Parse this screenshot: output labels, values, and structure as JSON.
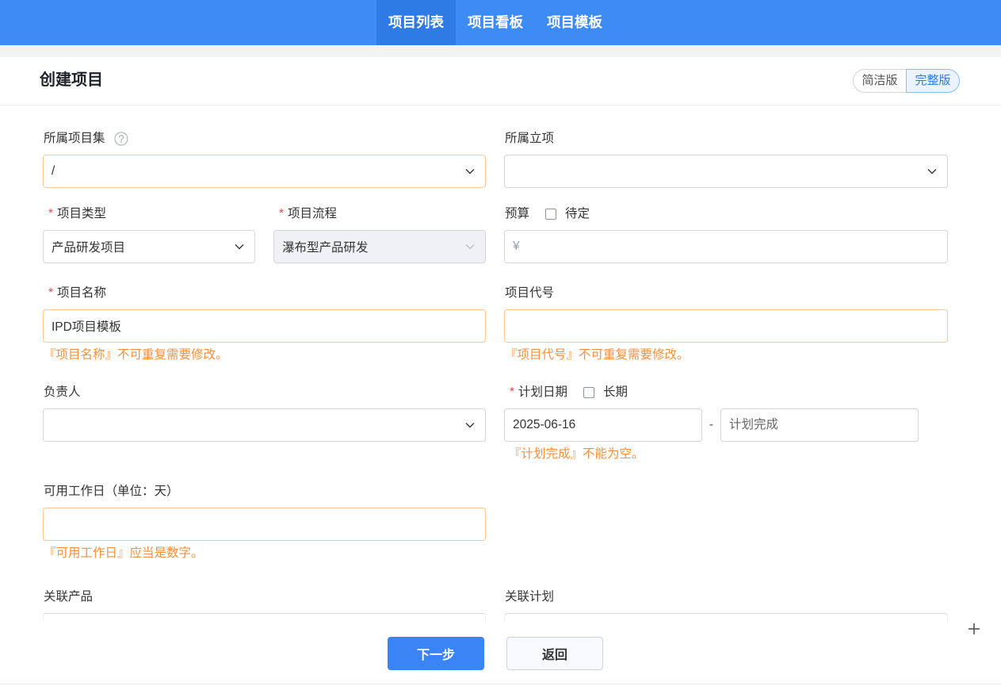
{
  "colors": {
    "brand": "#3d8bf5",
    "brand_active": "#2f7be6",
    "primary": "#3a84f6",
    "error": "#f5913e",
    "warning_border": "#f7c898",
    "required": "#e5484d"
  },
  "icons": {
    "help": "question-circle-icon",
    "select_arrow": "chevron-down-icon",
    "add": "plus-icon"
  },
  "nav": {
    "tabs": [
      {
        "label": "项目列表",
        "active": true
      },
      {
        "label": "项目看板",
        "active": false
      },
      {
        "label": "项目模板",
        "active": false
      }
    ]
  },
  "page": {
    "title": "创建项目",
    "mode_toggle": {
      "options": [
        {
          "label": "简洁版",
          "active": false
        },
        {
          "label": "完整版",
          "active": true
        }
      ]
    }
  },
  "form": {
    "required_mark": "*",
    "program": {
      "label": "所属项目集",
      "value": "/"
    },
    "charter": {
      "label": "所属立项",
      "value": ""
    },
    "type": {
      "label": "项目类型",
      "required": true,
      "value": "产品研发项目"
    },
    "workflow": {
      "label": "项目流程",
      "required": true,
      "value": "瀑布型产品研发",
      "disabled": true
    },
    "budget": {
      "label": "预算",
      "checkbox_label": "待定",
      "checked": false,
      "currency": "¥",
      "value": ""
    },
    "name": {
      "label": "项目名称",
      "required": true,
      "value": "IPD项目模板",
      "error": "『项目名称』不可重复需要修改。"
    },
    "code": {
      "label": "项目代号",
      "value": "",
      "error": "『项目代号』不可重复需要修改。"
    },
    "owner": {
      "label": "负责人",
      "value": ""
    },
    "plan_dates": {
      "label": "计划日期",
      "required": true,
      "checkbox_label": "长期",
      "checked": false,
      "begin": "2025-06-16",
      "separator": "-",
      "end_placeholder": "计划完成",
      "error": "『计划完成』不能为空。"
    },
    "workdays": {
      "label": "可用工作日（单位：天）",
      "value": "",
      "error": "『可用工作日』应当是数字。"
    },
    "products": {
      "label": "关联产品"
    },
    "plans": {
      "label": "关联计划"
    }
  },
  "footer": {
    "next_label": "下一步",
    "back_label": "返回"
  }
}
